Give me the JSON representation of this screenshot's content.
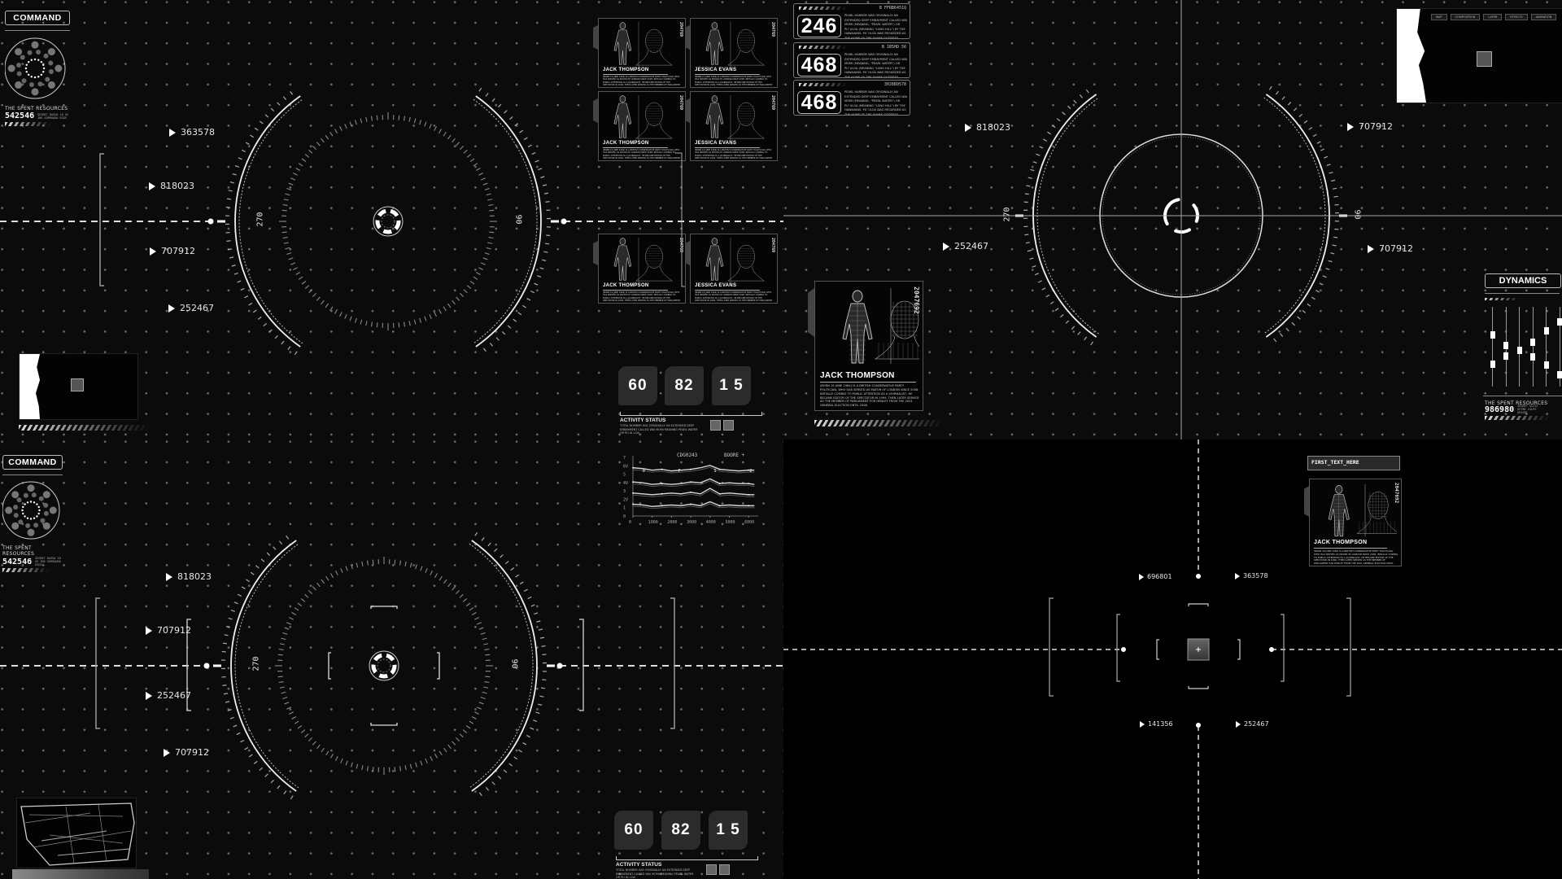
{
  "theme": {
    "background": "#0b0b0b",
    "foreground": "#ffffff",
    "grid_dot": "#6a6a6a",
    "panel": "#2b2b2b"
  },
  "top_left": {
    "command": {
      "title": "COMMAND",
      "resources_title": "THE SPENT RESOURCES",
      "resources_value": "542546",
      "resources_note": "SEGRET DAGGA 18 GS ING SORRAUDA EGGS"
    },
    "reticle": {
      "left_bearing": "270",
      "right_bearing": "90"
    },
    "targets": [
      {
        "value": "363578"
      },
      {
        "value": "818023"
      },
      {
        "value": "707912"
      },
      {
        "value": "252467"
      }
    ],
    "profiles": [
      {
        "name": "JACK THOMPSON",
        "id": "204769"
      },
      {
        "name": "JESSICA EVANS",
        "id": "204769"
      },
      {
        "name": "JACK THOMPSON",
        "id": "204769"
      },
      {
        "name": "JESSICA EVANS",
        "id": "204769"
      },
      {
        "name": "JACK THOMPSON",
        "id": "204769"
      },
      {
        "name": "JESSICA EVANS",
        "id": "204769"
      }
    ],
    "counters": [
      "60",
      "82",
      "1 5"
    ],
    "activity": {
      "title": "ACTIVITY STATUS",
      "text": "TOTAL NUMBER HAS ORIGINALLY AN EXTENDED DEEP EMBAYMENT CALLED WAI MOMI MEANING PEARL WATER OR PU UL LOA"
    }
  },
  "top_right": {
    "reticle": {
      "left_bearing": "270",
      "right_bearing": "90"
    },
    "number_panels": [
      {
        "value": "246",
        "code": "B FFRB6451Q",
        "text": "PEARL HARBOR WAS ORIGINALLY AN EXTENDED DEEP EMBAYMENT CALLED WAI MOMI (MEANING, \"PEARL WATER\") OR PU`ULOA (MEANING \"LONG HILL\") BY THE HAWAIIANS. PU`ULOA WAS REGARDED AS THE HOME OF THE SHARK GODDESS KA`AHUPAHAU AND HER BROTHER (OR SON), KAHI`UKA, IN HAWAIIAN LEGENDS. ACCORDING TO TRADITION, KEAUNUI ///"
      },
      {
        "value": "468",
        "code": "B 1B5HD 56",
        "text": "PEARL HARBOR WAS ORIGINALLY AN EXTENDED DEEP EMBAYMENT CALLED WAI MOMI (MEANING, \"PEARL WATER\") OR PU`ULOA (MEANING \"LONG HILL\") BY THE HAWAIIANS. PU`ULOA WAS REGARDED AS THE HOME OF THE SHARK GODDESS KA`AHUPAHAU AND HER BROTHER (OR SON), KAHI`UKA, IN HAWAIIAN LEGENDS. ACCORDING TO TRADITION, KEAUNUI ///"
      },
      {
        "value": "468",
        "code": "3HJ8B9578",
        "text": "PEARL HARBOR WAS ORIGINALLY AN EXTENDED DEEP EMBAYMENT CALLED WAI MOMI (MEANING, \"PEARL WATER\") OR PU`ULOA (MEANING \"LONG HILL\") BY THE HAWAIIANS. PU`ULOA WAS REGARDED AS THE HOME OF THE SHARK GODDESS KA`AHUPAHAU AND HER BROTHER (OR SON), KAHI`UKA, IN HAWAIIAN LEGENDS. ACCORDING TO TRADITION, KEAUNUI ///"
      }
    ],
    "targets": [
      {
        "value": "818023"
      },
      {
        "value": "707912"
      },
      {
        "value": "252467"
      },
      {
        "value": "707912"
      }
    ],
    "profile": {
      "name": "JACK THOMPSON",
      "id": "2047692",
      "bio": "(BORN 19 JUNE 1964) IS A BRITISH CONSERVATIVE PARTY POLITICIAN, WHO HAS SERVED AS MAYOR OF LONDON SINCE 2008. INITIALLY COMING TO PUBLIC ATTENTION AS A JOURNALIST, HE BECAME EDITOR OF THE SPECTATOR IN 1999. THEN LATER SERVED AS THE MEMBER OF PARLIAMENT FOR HENLEY FROM THE 2001 GENERAL ELECTION UNTIL 2008."
    },
    "map_tabs": [
      "MAP",
      "COMPOSITION",
      "LAYER",
      "EFFECTS",
      "ANIMATION"
    ],
    "dynamics": {
      "title": "DYNAMICS",
      "sliders": [
        {
          "upper": 0.35,
          "lower": 0.72
        },
        {
          "upper": 0.48,
          "lower": 0.62
        },
        {
          "upper": 0.55,
          "lower": null
        },
        {
          "upper": 0.44,
          "lower": 0.63
        },
        {
          "upper": 0.3,
          "lower": 0.73
        },
        {
          "upper": 0.19,
          "lower": 0.85
        }
      ],
      "resources_title": "THE SPENT RESOURCES",
      "resources_value": "986980",
      "resources_note": "SEGRET GLFGJ GETBE 24LPG UR4SBT"
    }
  },
  "bottom_left": {
    "command": {
      "title": "COMMAND",
      "resources_title": "THE SPENT RESOURCES",
      "resources_value": "542546",
      "resources_note": "SEGRET DAGGA 18 GS ING SORRAUDA EGGS"
    },
    "reticle": {
      "left_bearing": "270",
      "right_bearing": "90"
    },
    "targets": [
      {
        "value": "818023"
      },
      {
        "value": "707912"
      },
      {
        "value": "252467"
      },
      {
        "value": "707912"
      }
    ],
    "counters": [
      "60",
      "82",
      "1 5"
    ],
    "activity": {
      "title": "ACTIVITY STATUS",
      "text": "TOTAL NUMBER HAS ORIGINALLY AN EXTENDED DEEP EMBAYMENT CALLED WAI MOMI MEANING PEARL WATER OR PU UL LOA"
    },
    "chart_data": {
      "type": "line",
      "title": "",
      "header_labels": [
        "CDG0243",
        "BOORE +"
      ],
      "xlabel": "",
      "ylabel": "",
      "x_ticks": [
        "0",
        "1000",
        "2000",
        "3000",
        "4000",
        "5000",
        "6000"
      ],
      "y_ticks": [
        "7",
        "6V",
        "5",
        "4V",
        "3",
        "2V",
        "1",
        "0"
      ],
      "xlim": [
        0,
        6500
      ],
      "ylim": [
        0,
        7
      ],
      "grid": false,
      "series": [
        {
          "name": "s1",
          "x": [
            0,
            500,
            1000,
            1500,
            2000,
            2500,
            3000,
            3500,
            4000,
            4500,
            5000,
            5500,
            6000,
            6300
          ],
          "values": [
            6.1,
            6.0,
            5.8,
            5.9,
            5.7,
            5.8,
            5.9,
            6.1,
            6.4,
            5.9,
            5.8,
            5.7,
            5.8,
            5.8
          ]
        },
        {
          "name": "s2",
          "x": [
            0,
            500,
            1000,
            1500,
            2000,
            2500,
            3000,
            3500,
            4000,
            4500,
            5000,
            5500,
            6000,
            6300
          ],
          "values": [
            4.3,
            4.2,
            4.0,
            4.1,
            4.0,
            4.1,
            4.3,
            4.2,
            4.7,
            4.1,
            4.2,
            4.1,
            4.1,
            4.0
          ]
        },
        {
          "name": "s3",
          "x": [
            0,
            500,
            1000,
            1500,
            2000,
            2500,
            3000,
            3500,
            4000,
            4500,
            5000,
            5500,
            6000,
            6300
          ],
          "values": [
            2.9,
            2.8,
            2.7,
            2.8,
            2.9,
            2.8,
            3.0,
            2.8,
            3.5,
            2.8,
            2.9,
            2.8,
            2.7,
            2.7
          ]
        },
        {
          "name": "s4",
          "x": [
            0,
            500,
            1000,
            1500,
            2000,
            2500,
            3000,
            3500,
            4000,
            4500,
            5000,
            5500,
            6000,
            6300
          ],
          "values": [
            1.5,
            1.4,
            1.2,
            1.3,
            1.4,
            1.3,
            1.5,
            1.3,
            1.8,
            1.3,
            1.4,
            1.3,
            1.3,
            1.3
          ]
        }
      ],
      "markers": [
        "0",
        "F",
        "S",
        "2"
      ],
      "legend": "none"
    }
  },
  "bottom_right": {
    "first_text": "FIRST_TEXT_HERE",
    "profile": {
      "name": "JACK THOMPSON",
      "id": "2047692"
    },
    "targets": [
      {
        "value": "696801"
      },
      {
        "value": "363578"
      },
      {
        "value": "141356"
      },
      {
        "value": "252467"
      }
    ]
  }
}
